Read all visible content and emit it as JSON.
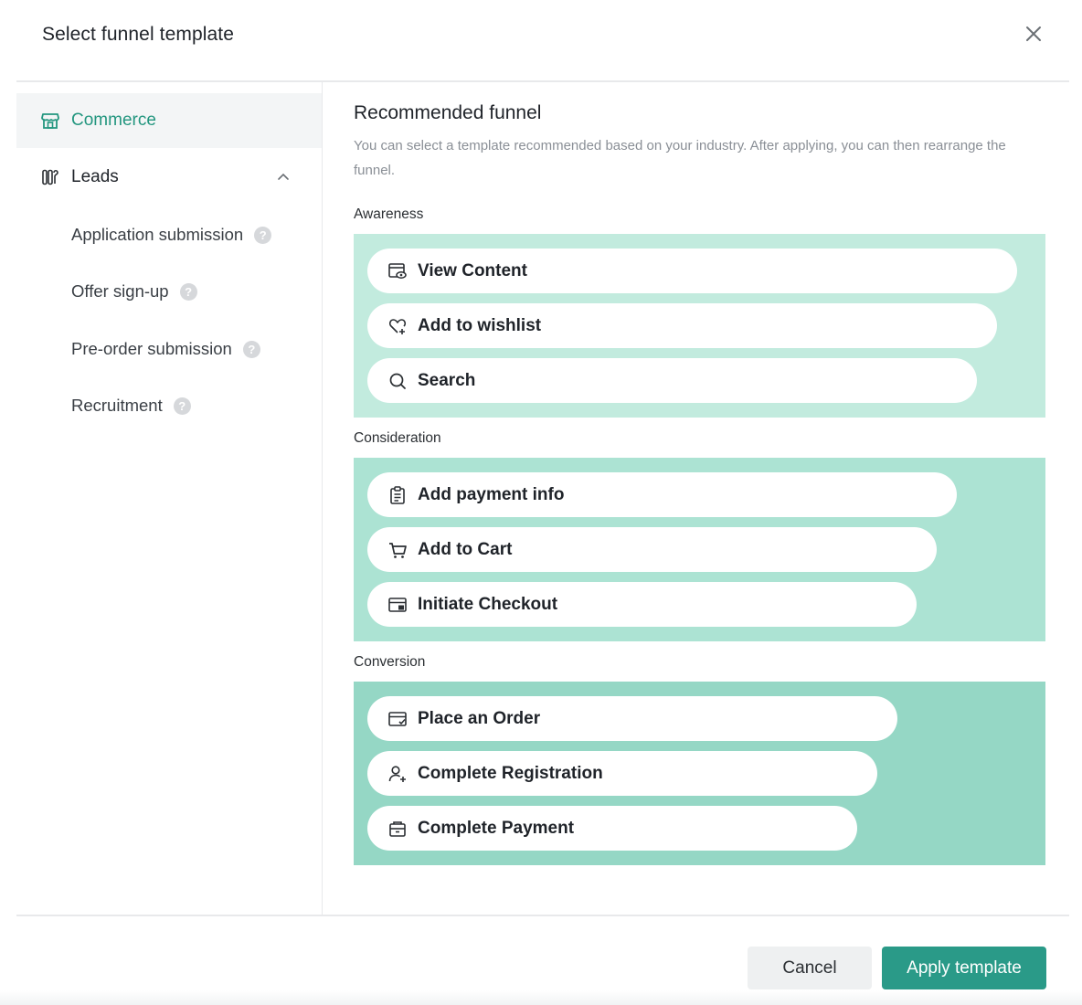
{
  "modal": {
    "title": "Select funnel template"
  },
  "sidebar": {
    "categories": [
      {
        "label": "Commerce",
        "icon": "store-icon",
        "active": true
      },
      {
        "label": "Leads",
        "icon": "leads-icon",
        "expanded": true
      }
    ],
    "leads_items": [
      {
        "label": "Application submission"
      },
      {
        "label": "Offer sign-up"
      },
      {
        "label": "Pre-order submission"
      },
      {
        "label": "Recruitment"
      }
    ]
  },
  "main": {
    "heading": "Recommended funnel",
    "description": "You can select a template recommended based on your industry. After applying, you can then rearrange the funnel.",
    "stages": [
      {
        "label": "Awareness",
        "events": [
          {
            "label": "View Content",
            "icon": "view-content-icon"
          },
          {
            "label": "Add to wishlist",
            "icon": "wishlist-heart-icon"
          },
          {
            "label": "Search",
            "icon": "search-icon"
          }
        ]
      },
      {
        "label": "Consideration",
        "events": [
          {
            "label": "Add payment info",
            "icon": "clipboard-icon"
          },
          {
            "label": "Add to Cart",
            "icon": "cart-icon"
          },
          {
            "label": "Initiate Checkout",
            "icon": "checkout-icon"
          }
        ]
      },
      {
        "label": "Conversion",
        "events": [
          {
            "label": "Place an Order",
            "icon": "order-icon"
          },
          {
            "label": "Complete Registration",
            "icon": "user-add-icon"
          },
          {
            "label": "Complete Payment",
            "icon": "wallet-icon"
          }
        ]
      }
    ]
  },
  "footer": {
    "cancel_label": "Cancel",
    "apply_label": "Apply template"
  },
  "colors": {
    "accent": "#23967f",
    "apply_button": "#2a9a88",
    "awareness_bg": "#c2ebde",
    "consideration_bg": "#ace3d3",
    "conversion_bg": "#95d7c5"
  }
}
